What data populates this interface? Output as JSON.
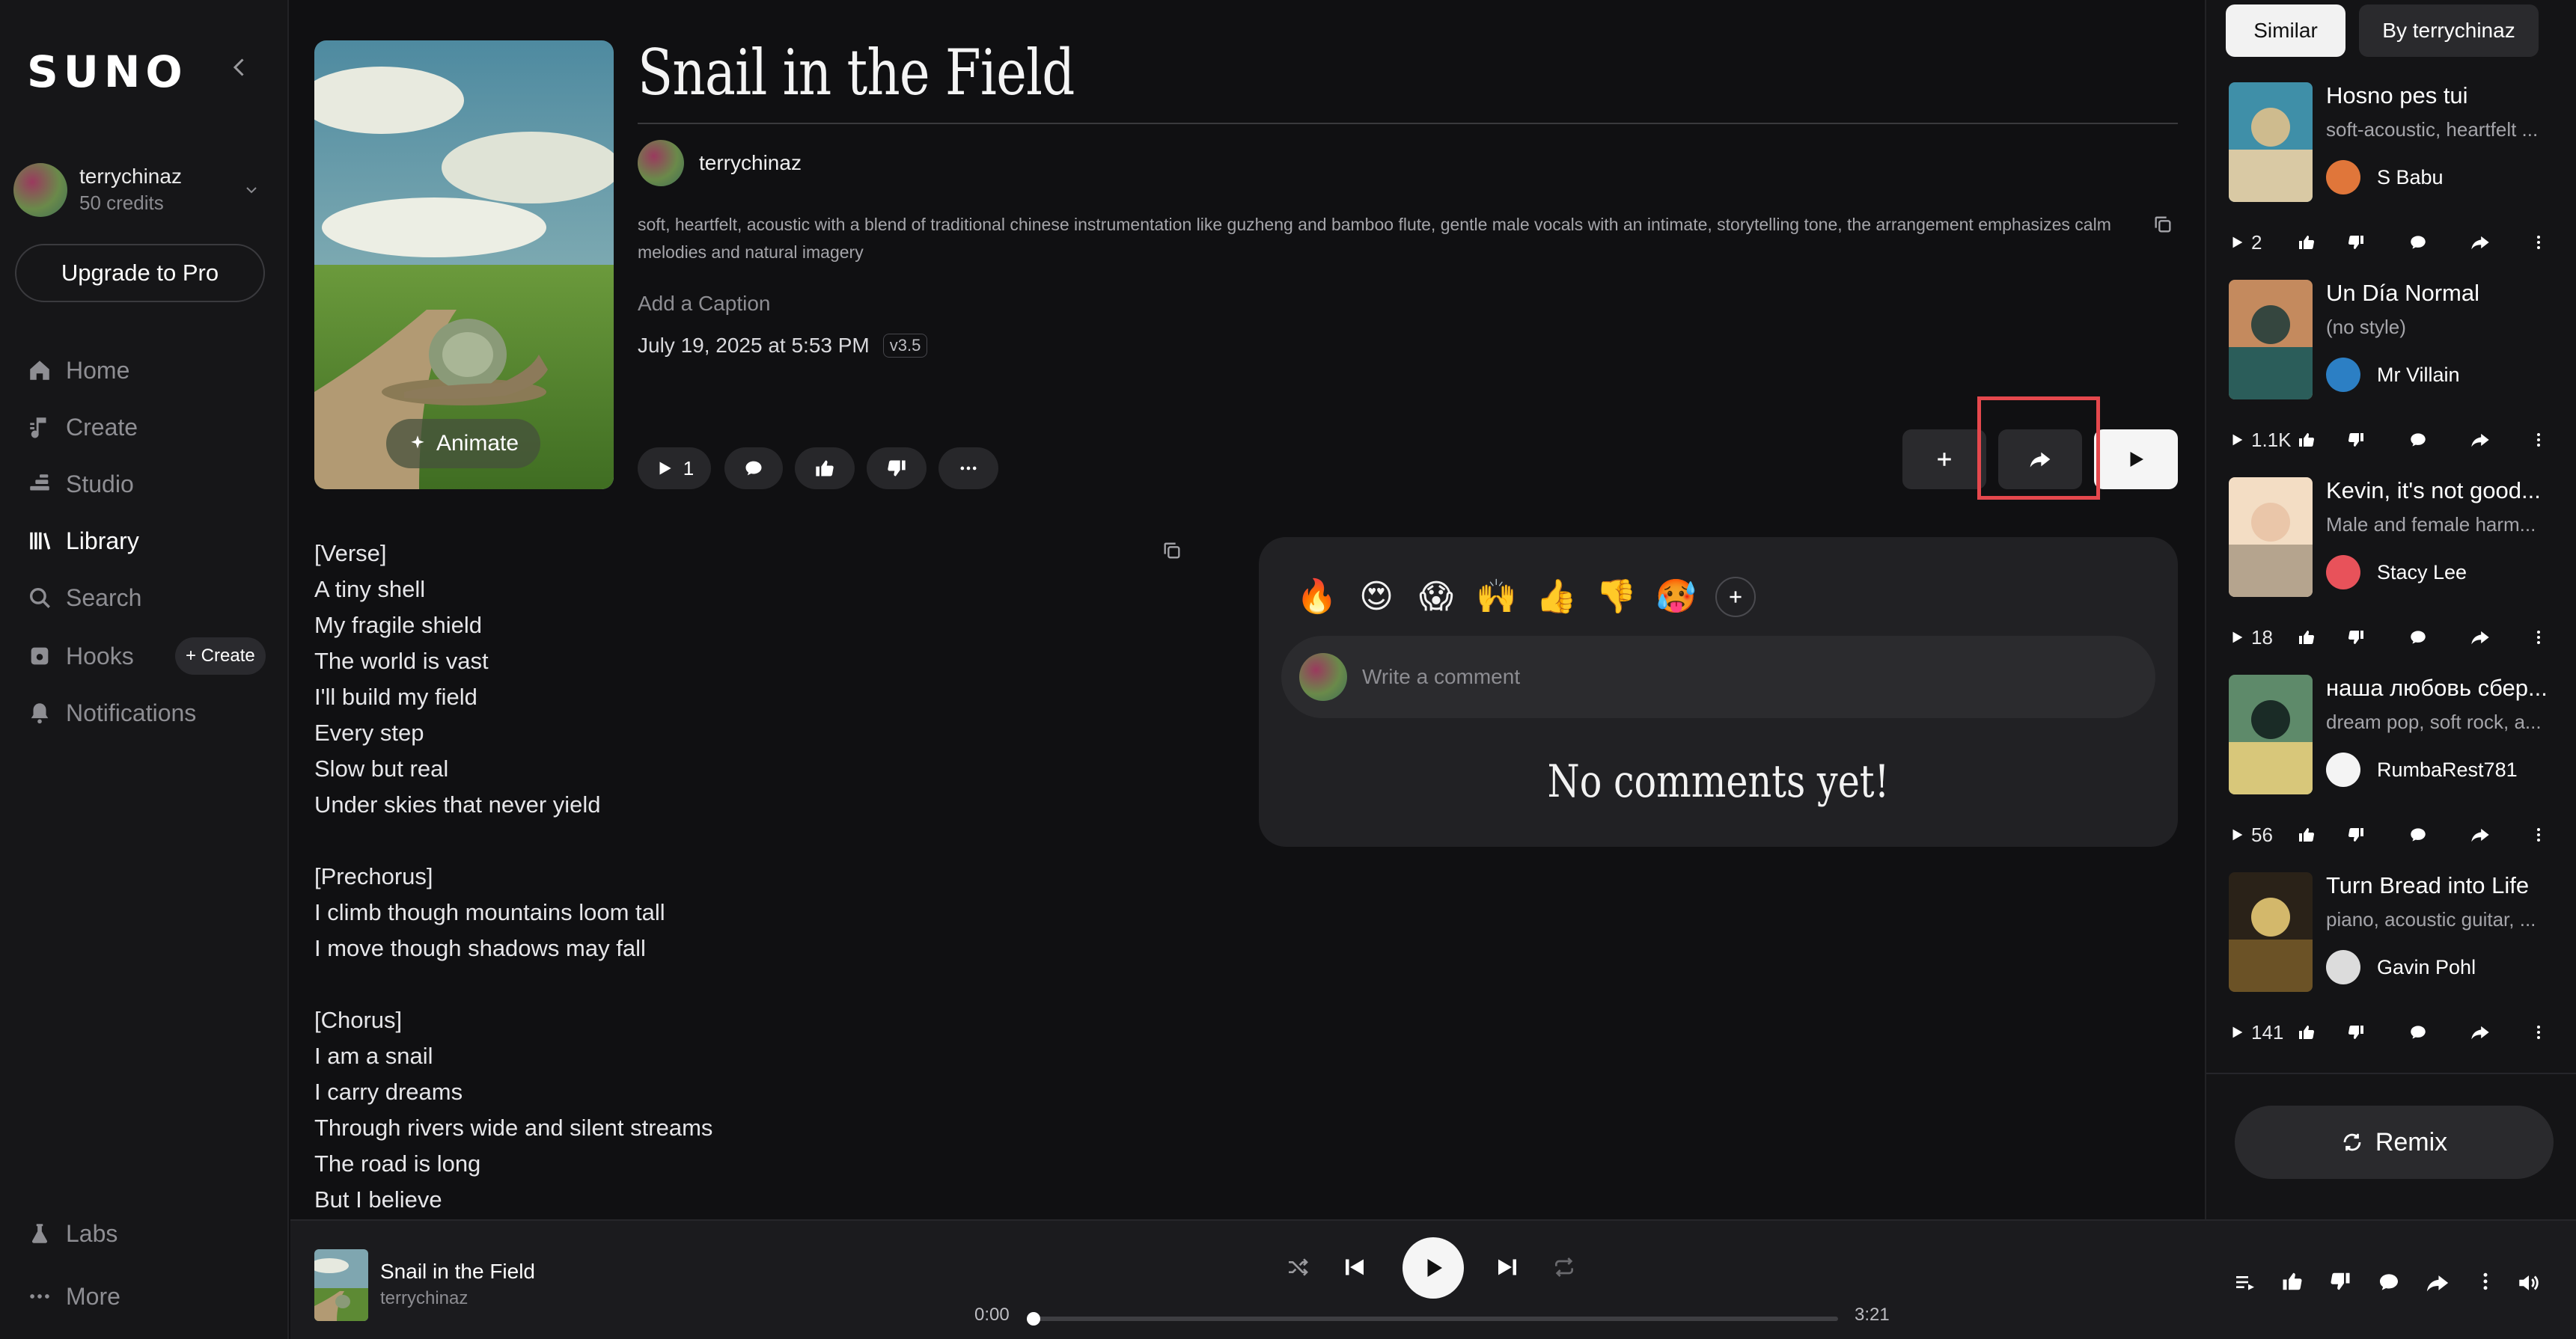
{
  "app": {
    "logo": "SUNO"
  },
  "sidebar": {
    "user": {
      "name": "terrychinaz",
      "credits": "50 credits"
    },
    "upgrade_label": "Upgrade to Pro",
    "nav": [
      {
        "label": "Home",
        "icon": "home-icon"
      },
      {
        "label": "Create",
        "icon": "music-note-icon"
      },
      {
        "label": "Studio",
        "icon": "studio-icon"
      },
      {
        "label": "Library",
        "icon": "library-icon"
      },
      {
        "label": "Search",
        "icon": "search-icon"
      },
      {
        "label": "Hooks",
        "icon": "hooks-icon"
      },
      {
        "label": "Notifications",
        "icon": "bell-icon"
      }
    ],
    "hooks_create_label": "+ Create",
    "labs_label": "Labs",
    "more_label": "More"
  },
  "song": {
    "title": "Snail in the Field",
    "artist": "terrychinaz",
    "style": "soft, heartfelt, acoustic with a blend of traditional chinese instrumentation like guzheng and bamboo flute, gentle male vocals with an intimate, storytelling tone, the arrangement emphasizes calm melodies and natural imagery",
    "caption_placeholder": "Add a Caption",
    "date": "July 19, 2025 at 5:53 PM",
    "version": "v3.5",
    "play_count": "1",
    "animate_label": "Animate",
    "lyrics": [
      "[Verse]",
      "A tiny shell",
      "My fragile shield",
      "The world is vast",
      "I'll build my field",
      "Every step",
      "Slow but real",
      "Under skies that never yield",
      "",
      "[Prechorus]",
      "I climb though mountains loom tall",
      "I move though shadows may fall",
      "",
      "[Chorus]",
      "I am a snail",
      "I carry dreams",
      "Through rivers wide and silent streams",
      "The road is long",
      "But I believe"
    ]
  },
  "comments": {
    "emojis": [
      "🔥",
      "😍",
      "😱",
      "🙌",
      "👍",
      "👎",
      "🥵"
    ],
    "placeholder": "Write a comment",
    "empty_text": "No comments yet!"
  },
  "right_panel": {
    "tabs": [
      "Similar",
      "By terrychinaz"
    ],
    "items": [
      {
        "title": "Hosno pes tui",
        "style": "soft-acoustic, heartfelt ...",
        "user": "S Babu",
        "plays": "2"
      },
      {
        "title": "Un Día Normal",
        "style": "(no style)",
        "user": "Mr Villain",
        "plays": "1.1K"
      },
      {
        "title": "Kevin, it's not good...",
        "style": "Male and female harm...",
        "user": "Stacy Lee",
        "plays": "18"
      },
      {
        "title": "наша любовь сбер...",
        "style": "dream pop, soft rock, a...",
        "user": "RumbaRest781",
        "plays": "56"
      },
      {
        "title": "Turn Bread into Life",
        "style": "piano, acoustic guitar, ...",
        "user": "Gavin Pohl",
        "plays": "141"
      }
    ],
    "remix_label": "Remix"
  },
  "player": {
    "title": "Snail in the Field",
    "artist": "terrychinaz",
    "current_time": "0:00",
    "duration": "3:21",
    "progress": 0
  }
}
